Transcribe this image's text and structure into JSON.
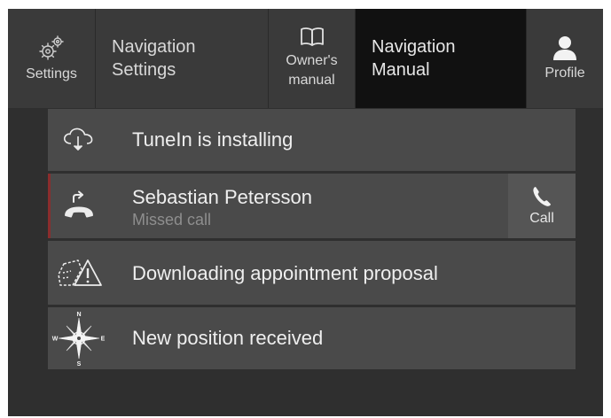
{
  "topbar": {
    "tabs": [
      {
        "id": "settings",
        "label": "Settings",
        "icon": "gears-icon"
      },
      {
        "id": "navigation-settings",
        "label_line1": "Navigation",
        "label_line2": "Settings"
      },
      {
        "id": "owners-manual",
        "label_line1": "Owner's",
        "label_line2": "manual",
        "icon": "book-icon"
      },
      {
        "id": "navigation-manual",
        "label_line1": "Navigation",
        "label_line2": "Manual",
        "active": true
      },
      {
        "id": "profile",
        "label": "Profile",
        "icon": "person-icon"
      }
    ]
  },
  "notifications": [
    {
      "icon": "cloud-download-icon",
      "title": "TuneIn is installing"
    },
    {
      "icon": "missed-call-icon",
      "title": "Sebastian Petersson",
      "subtitle": "Missed call",
      "action": {
        "label": "Call",
        "icon": "phone-icon"
      }
    },
    {
      "icon": "appointment-warning-icon",
      "title": "Downloading appointment proposal"
    },
    {
      "icon": "compass-rose-icon",
      "title": "New position received",
      "compass": {
        "n": "N",
        "s": "S",
        "e": "E",
        "w": "W"
      }
    }
  ],
  "colors": {
    "background": "#2f2f2f",
    "topbar": "#3a3a3a",
    "active_tab": "#111111",
    "row": "#4a4a4a",
    "missed_accent": "#8a2d2d",
    "subtitle": "#8e8e8e"
  }
}
